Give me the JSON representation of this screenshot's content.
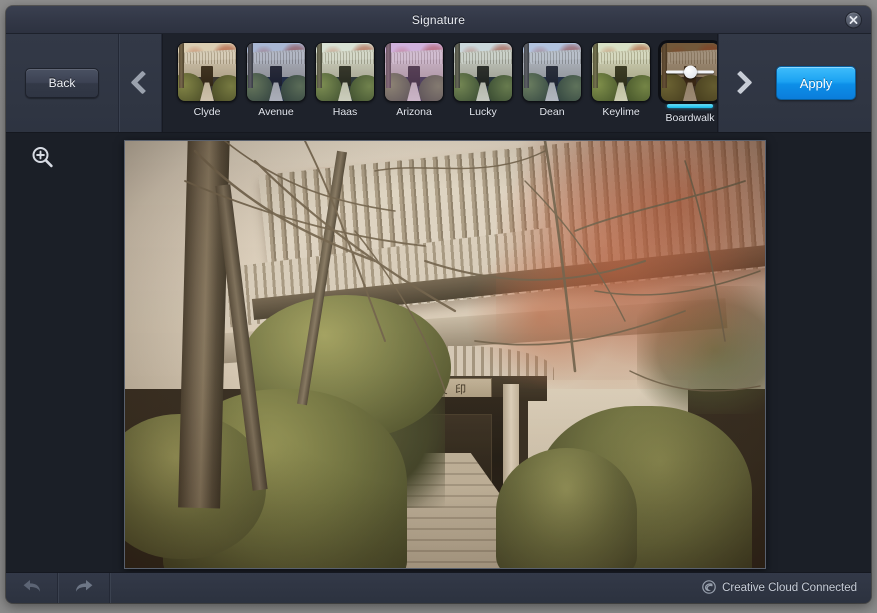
{
  "window": {
    "title": "Signature",
    "close_icon": "close-circle-icon"
  },
  "toolbar": {
    "back_label": "Back",
    "apply_label": "Apply",
    "prev_icon": "chevron-left-icon",
    "next_icon": "chevron-right-icon"
  },
  "filters": [
    {
      "name": "Clyde",
      "selected": false,
      "sky": "#efe7d4",
      "tint": "rgba(150,120,60,0.22)"
    },
    {
      "name": "Avenue",
      "selected": false,
      "sky": "#dbe4ef",
      "tint": "rgba(40,70,140,0.28)"
    },
    {
      "name": "Haas",
      "selected": false,
      "sky": "#eef1e8",
      "tint": "rgba(120,160,120,0.18)"
    },
    {
      "name": "Arizona",
      "selected": false,
      "sky": "#e6d3ec",
      "tint": "rgba(168,120,190,0.36)"
    },
    {
      "name": "Lucky",
      "selected": false,
      "sky": "#e8edf0",
      "tint": "rgba(70,120,130,0.18)"
    },
    {
      "name": "Dean",
      "selected": false,
      "sky": "#dfe8f4",
      "tint": "rgba(50,90,160,0.26)"
    },
    {
      "name": "Keylime",
      "selected": false,
      "sky": "#edf0e4",
      "tint": "rgba(140,170,80,0.20)"
    },
    {
      "name": "Boardwalk",
      "selected": true,
      "sky": "#8a7456",
      "tint": "rgba(90,60,28,0.50)"
    },
    {
      "name": "",
      "selected": false,
      "sky": "#eae6dc",
      "tint": "rgba(120,110,90,0.15)"
    }
  ],
  "selection": {
    "slider_value": 50,
    "accent_color": "#16b9e8"
  },
  "canvas": {
    "zoom_icon": "zoom-in-magnifier-icon",
    "photo_alt": "Japanese temple entrance with tiled roof, hedges and stone path"
  },
  "statusbar": {
    "undo_icon": "undo-arrow-icon",
    "redo_icon": "redo-arrow-icon",
    "cloud_icon": "creative-cloud-icon",
    "cloud_label": "Creative Cloud Connected"
  }
}
